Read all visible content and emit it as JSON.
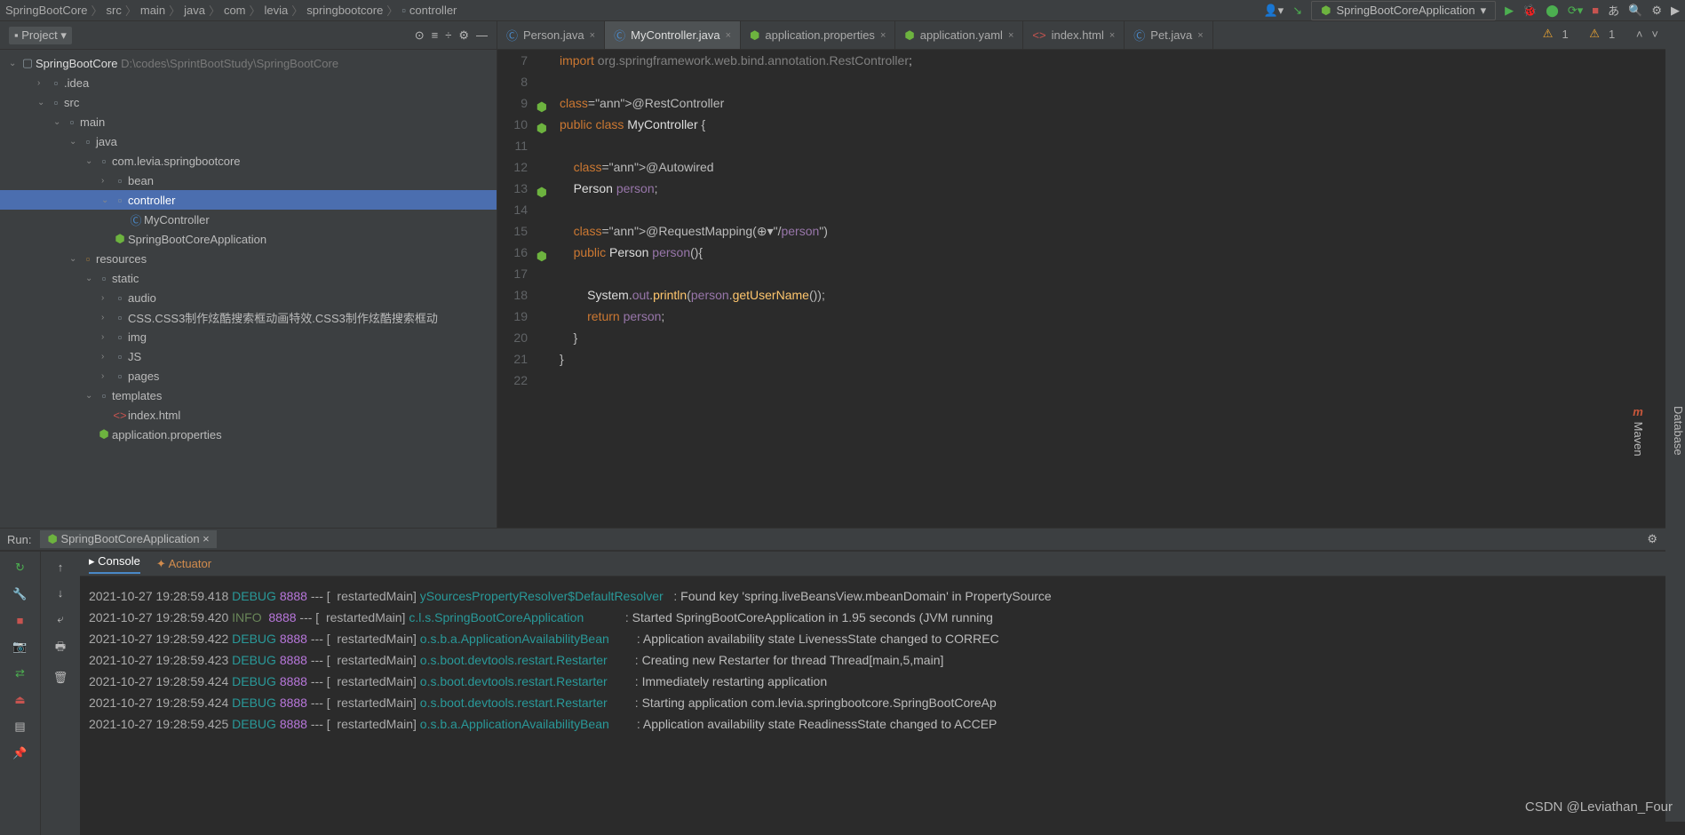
{
  "breadcrumb": [
    "SpringBootCore",
    "src",
    "main",
    "java",
    "com",
    "levia",
    "springbootcore",
    "controller"
  ],
  "runConfig": "SpringBootCoreApplication",
  "projectPanel": {
    "title": "Project"
  },
  "projectRoot": {
    "name": "SpringBootCore",
    "path": "D:\\codes\\SprintBootStudy\\SpringBootCore"
  },
  "tree": [
    {
      "d": 1,
      "chev": "›",
      "icon": "folder",
      "label": ".idea"
    },
    {
      "d": 1,
      "chev": "⌄",
      "icon": "folder",
      "label": "src"
    },
    {
      "d": 2,
      "chev": "⌄",
      "icon": "folder",
      "label": "main"
    },
    {
      "d": 3,
      "chev": "⌄",
      "icon": "folder",
      "label": "java"
    },
    {
      "d": 4,
      "chev": "⌄",
      "icon": "pkg",
      "label": "com.levia.springbootcore"
    },
    {
      "d": 5,
      "chev": "›",
      "icon": "pkg",
      "label": "bean"
    },
    {
      "d": 5,
      "chev": "⌄",
      "icon": "pkg",
      "label": "controller",
      "sel": true
    },
    {
      "d": 6,
      "chev": "",
      "icon": "class",
      "label": "MyController"
    },
    {
      "d": 5,
      "chev": "",
      "icon": "spring",
      "label": "SpringBootCoreApplication"
    },
    {
      "d": 3,
      "chev": "⌄",
      "icon": "res",
      "label": "resources"
    },
    {
      "d": 4,
      "chev": "⌄",
      "icon": "folder",
      "label": "static"
    },
    {
      "d": 5,
      "chev": "›",
      "icon": "folder",
      "label": "audio"
    },
    {
      "d": 5,
      "chev": "›",
      "icon": "folder",
      "label": "CSS.CSS3制作炫酷搜索框动画特效.CSS3制作炫酷搜索框动"
    },
    {
      "d": 5,
      "chev": "›",
      "icon": "folder",
      "label": "img"
    },
    {
      "d": 5,
      "chev": "›",
      "icon": "folder",
      "label": "JS"
    },
    {
      "d": 5,
      "chev": "›",
      "icon": "folder",
      "label": "pages"
    },
    {
      "d": 4,
      "chev": "⌄",
      "icon": "folder",
      "label": "templates"
    },
    {
      "d": 5,
      "chev": "",
      "icon": "html",
      "label": "index.html"
    },
    {
      "d": 4,
      "chev": "",
      "icon": "spring",
      "label": "application.properties"
    }
  ],
  "tabs": [
    {
      "icon": "class",
      "label": "Person.java"
    },
    {
      "icon": "class",
      "label": "MyController.java",
      "active": true
    },
    {
      "icon": "spring",
      "label": "application.properties"
    },
    {
      "icon": "spring",
      "label": "application.yaml"
    },
    {
      "icon": "html",
      "label": "index.html"
    },
    {
      "icon": "class",
      "label": "Pet.java"
    }
  ],
  "warnings": {
    "a": "1",
    "b": "1"
  },
  "code": {
    "start": 7,
    "marks": {
      "9": "spring",
      "10": "spring",
      "13": "spring",
      "16": "spring"
    },
    "lines": [
      "import org.springframework.web.bind.annotation.RestController;",
      "",
      "@RestController",
      "public class MyController {",
      "",
      "    @Autowired",
      "    Person person;",
      "",
      "    @RequestMapping(⊕▾\"/person\")",
      "    public Person person(){",
      "",
      "        System.out.println(person.getUserName());",
      "        return person;",
      "    }",
      "}",
      ""
    ]
  },
  "runHeader": {
    "label": "Run:",
    "target": "SpringBootCoreApplication"
  },
  "runTabs": [
    "Console",
    "Actuator"
  ],
  "logs": [
    {
      "t": "2021-10-27 19:28:59.418",
      "lvl": "DEBUG",
      "pid": "8888",
      "thr": "restartedMain",
      "src": "ySourcesPropertyResolver$DefaultResolver",
      "msg": "Found key 'spring.liveBeansView.mbeanDomain' in PropertySource"
    },
    {
      "t": "2021-10-27 19:28:59.420",
      "lvl": "INFO",
      "pid": "8888",
      "thr": "restartedMain",
      "src": "c.l.s.SpringBootCoreApplication",
      "msg": "Started SpringBootCoreApplication in 1.95 seconds (JVM running"
    },
    {
      "t": "2021-10-27 19:28:59.422",
      "lvl": "DEBUG",
      "pid": "8888",
      "thr": "restartedMain",
      "src": "o.s.b.a.ApplicationAvailabilityBean",
      "msg": "Application availability state LivenessState changed to CORREC"
    },
    {
      "t": "2021-10-27 19:28:59.423",
      "lvl": "DEBUG",
      "pid": "8888",
      "thr": "restartedMain",
      "src": "o.s.boot.devtools.restart.Restarter",
      "msg": "Creating new Restarter for thread Thread[main,5,main]"
    },
    {
      "t": "2021-10-27 19:28:59.424",
      "lvl": "DEBUG",
      "pid": "8888",
      "thr": "restartedMain",
      "src": "o.s.boot.devtools.restart.Restarter",
      "msg": "Immediately restarting application"
    },
    {
      "t": "2021-10-27 19:28:59.424",
      "lvl": "DEBUG",
      "pid": "8888",
      "thr": "restartedMain",
      "src": "o.s.boot.devtools.restart.Restarter",
      "msg": "Starting application com.levia.springbootcore.SpringBootCoreAp"
    },
    {
      "t": "2021-10-27 19:28:59.425",
      "lvl": "DEBUG",
      "pid": "8888",
      "thr": "restartedMain",
      "src": "o.s.b.a.ApplicationAvailabilityBean",
      "msg": "Application availability state ReadinessState changed to ACCEP"
    }
  ],
  "watermark": "CSDN @Leviathan_Four",
  "rightStrip": [
    "Database",
    "Maven"
  ]
}
